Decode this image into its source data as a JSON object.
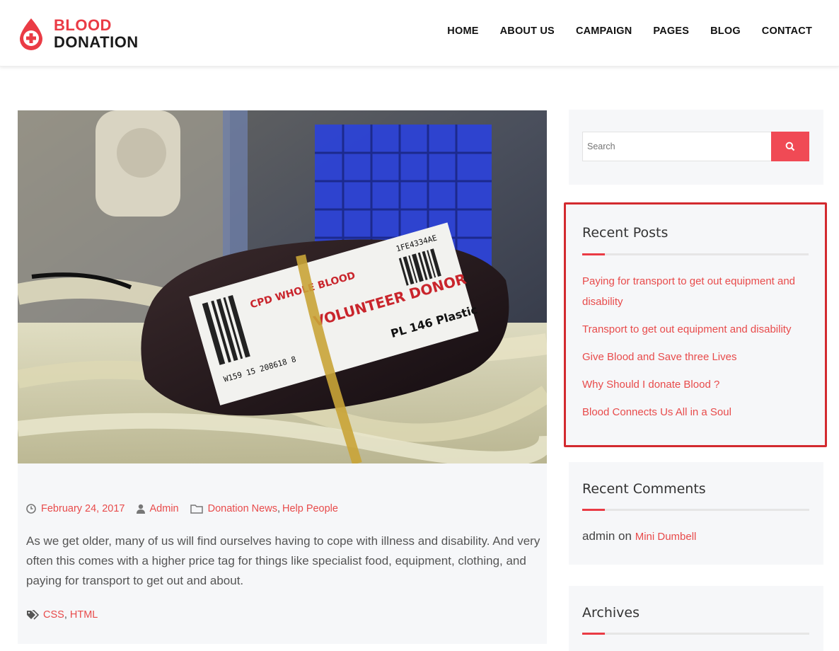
{
  "logo": {
    "line1": "BLOOD",
    "line2": "DONATION"
  },
  "nav": [
    "HOME",
    "ABOUT US",
    "CAMPAIGN",
    "PAGES",
    "BLOG",
    "CONTACT"
  ],
  "post": {
    "image_alt": "blood-bag-photo",
    "date": "February 24, 2017",
    "author": "Admin",
    "category1": "Donation News",
    "category2": "Help People",
    "excerpt": "As we get older, many of us will find ourselves having to cope with illness and disability. And very often this comes with a higher price tag for things like specialist food, equipment, clothing, and paying for transport to get out and about.",
    "tag1": "CSS",
    "tag2": "HTML",
    "bag_label1": "CPD WHOLE BLOOD",
    "bag_label2": "VOLUNTEER DONOR",
    "bag_label3": "PL 146 Plastic",
    "bag_label4": "W159 15 208618 8",
    "bag_label5": "1FE4334AE"
  },
  "search": {
    "placeholder": "Search"
  },
  "recent_posts": {
    "title": "Recent Posts",
    "items": [
      "Paying for transport to get out equipment and disability",
      "Transport to get out equipment and disability",
      "Give Blood and Save three Lives",
      "Why Should I donate Blood ?",
      "Blood Connects Us All in a Soul"
    ]
  },
  "recent_comments": {
    "title": "Recent Comments",
    "author": "admin",
    "on": "on",
    "post": "Mini Dumbell"
  },
  "archives": {
    "title": "Archives"
  },
  "colors": {
    "accent": "#ea3b45",
    "link": "#e84b4b",
    "highlight_border": "#d32a2f"
  }
}
